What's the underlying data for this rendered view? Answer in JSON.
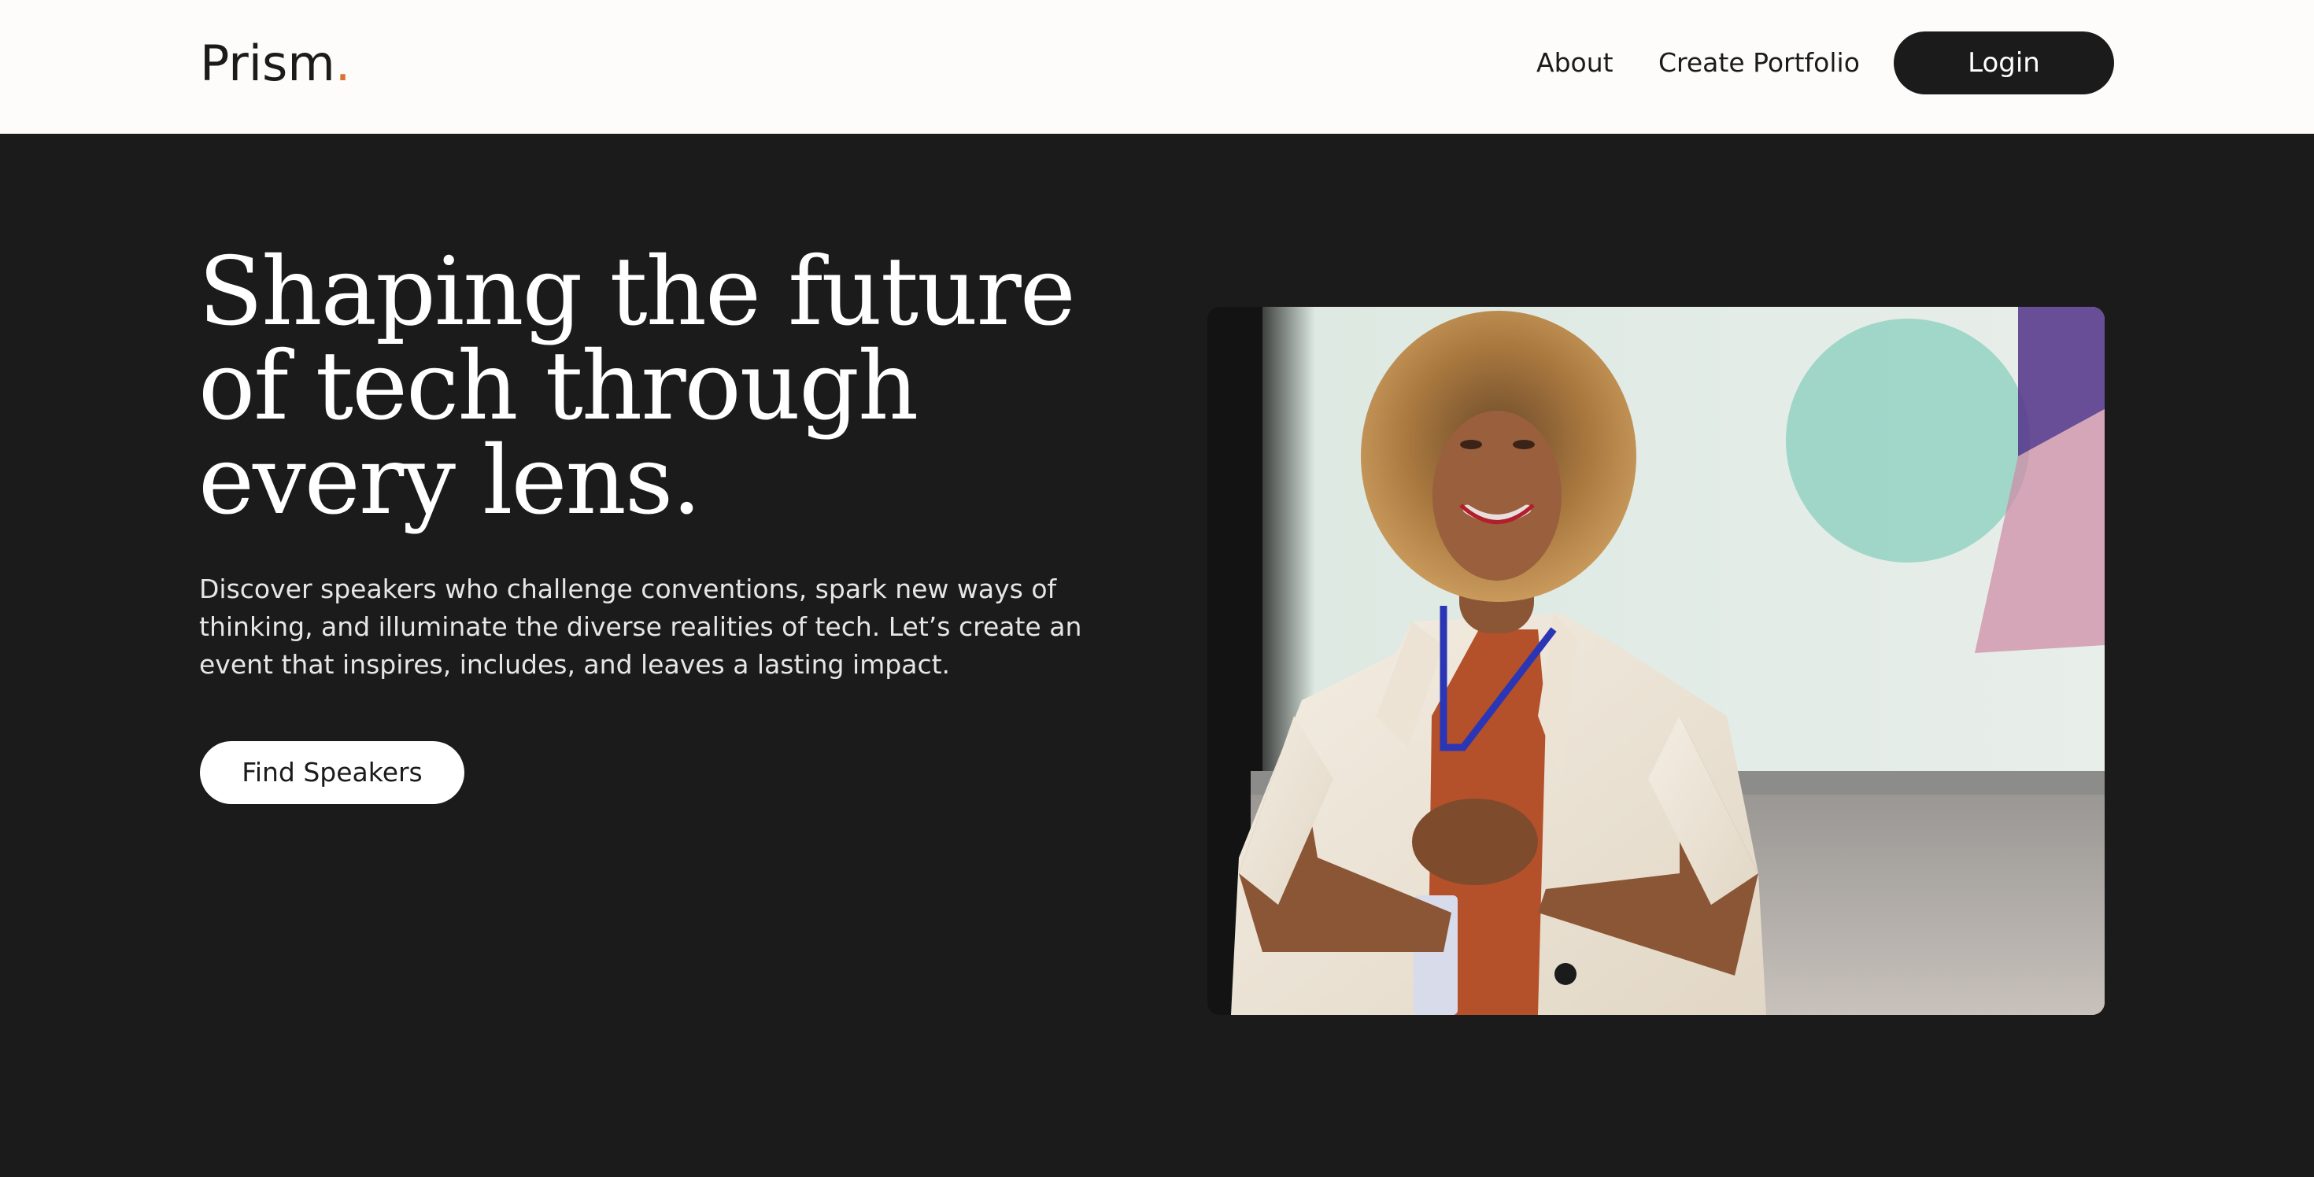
{
  "header": {
    "logo_text": "Prism",
    "logo_dot": ".",
    "nav": {
      "about": "About",
      "create_portfolio": "Create Portfolio"
    },
    "login_label": "Login"
  },
  "hero": {
    "title": "Shaping the future of tech through every lens.",
    "description": "Discover speakers who challenge conventions, spark new ways of thinking, and illuminate the diverse realities of tech. Let’s create an event that inspires, includes, and leaves a lasting impact.",
    "cta_label": "Find Speakers"
  },
  "colors": {
    "accent": "#e0702f",
    "dark": "#1b1b1b",
    "header_bg": "#fdfcfa",
    "white": "#ffffff"
  },
  "icons": {
    "hero_image": "speaker-photo"
  }
}
